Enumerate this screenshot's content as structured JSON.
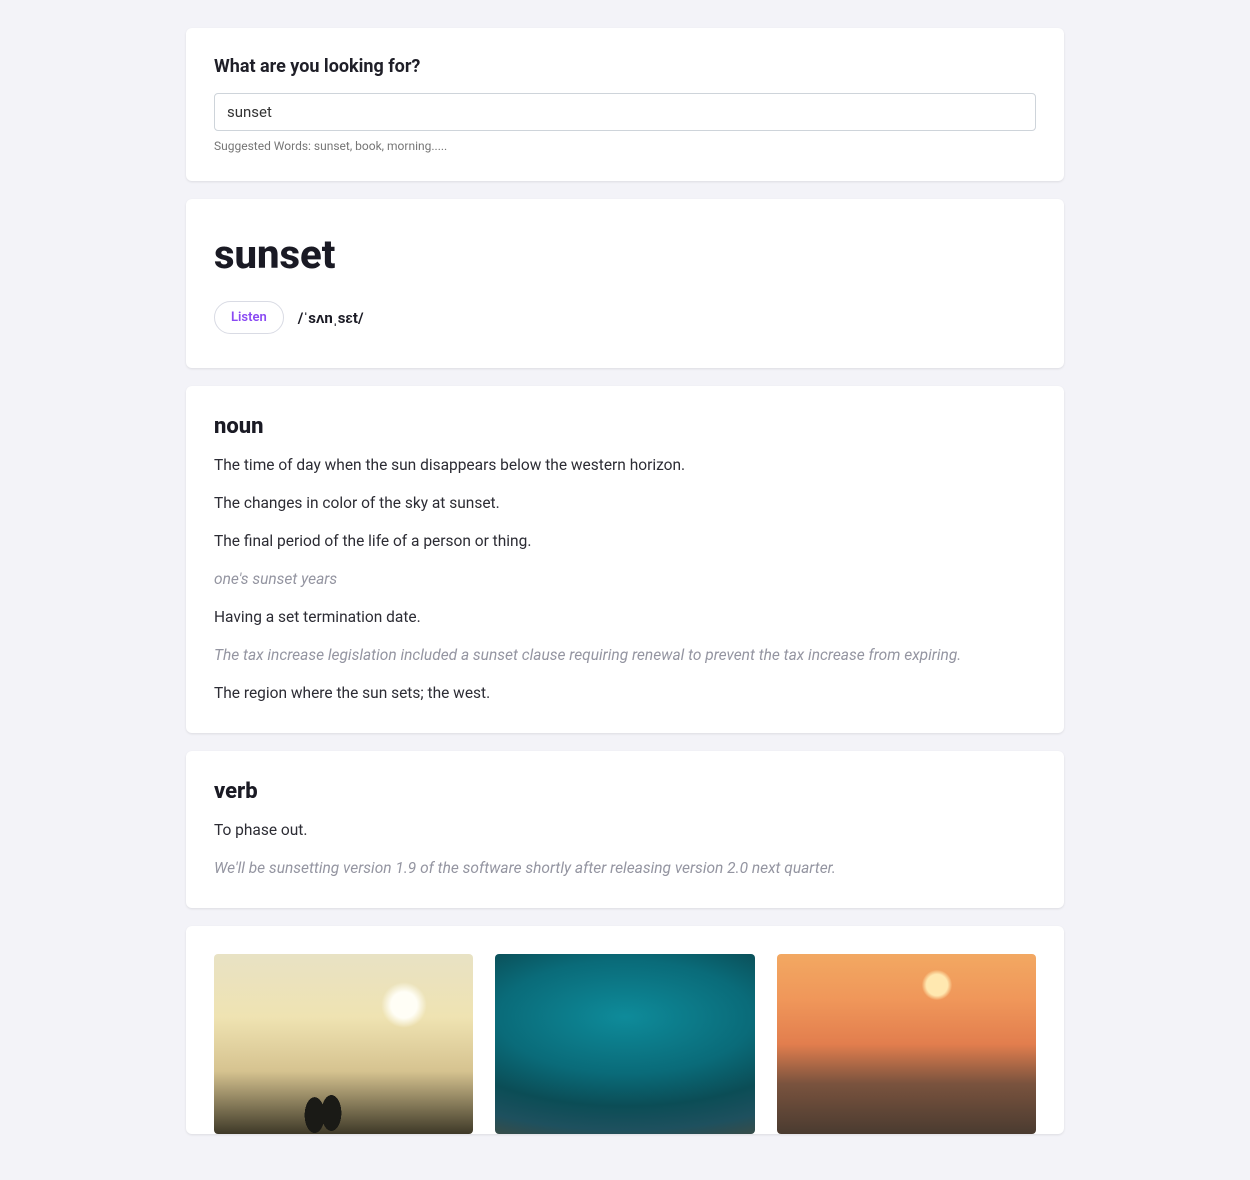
{
  "search": {
    "title": "What are you looking for?",
    "value": "sunset",
    "suggested": "Suggested Words: sunset, book, morning....."
  },
  "word": {
    "title": "sunset",
    "listen_label": "Listen",
    "pronunciation": "/ˈsʌnˌsɛt/"
  },
  "parts": [
    {
      "pos": "noun",
      "defs": [
        {
          "text": "The time of day when the sun disappears below the western horizon.",
          "example": ""
        },
        {
          "text": "The changes in color of the sky at sunset.",
          "example": ""
        },
        {
          "text": "The final period of the life of a person or thing.",
          "example": "one's sunset years"
        },
        {
          "text": "Having a set termination date.",
          "example": "The tax increase legislation included a sunset clause requiring renewal to prevent the tax increase from expiring."
        },
        {
          "text": "The region where the sun sets; the west.",
          "example": ""
        }
      ]
    },
    {
      "pos": "verb",
      "defs": [
        {
          "text": "To phase out.",
          "example": "We'll be sunsetting version 1.9 of the software shortly after releasing version 2.0 next quarter."
        }
      ]
    }
  ]
}
